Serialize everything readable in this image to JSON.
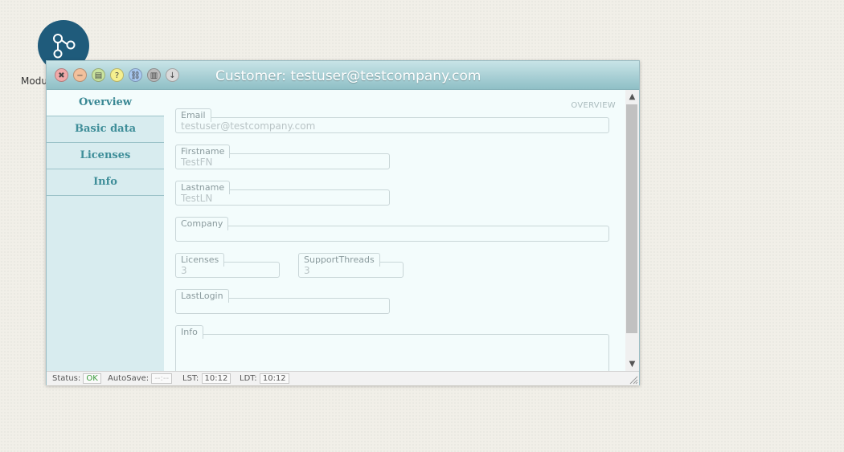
{
  "desktop": {
    "icon_label": "Modu"
  },
  "window": {
    "title": "Customer: testuser@testcompany.com",
    "titlebar_buttons": [
      {
        "name": "close-button",
        "glyph": "✖",
        "color": "#f0a9a9"
      },
      {
        "name": "minimize-button",
        "glyph": "−",
        "color": "#f2c09c"
      },
      {
        "name": "save-button",
        "glyph": "▤",
        "color": "#c9e39e"
      },
      {
        "name": "help-button",
        "glyph": "?",
        "color": "#f5ef8e"
      },
      {
        "name": "link-button",
        "glyph": "⛓",
        "color": "#a9c9f2"
      },
      {
        "name": "list-button",
        "glyph": "▥",
        "color": "#bbbbbb"
      },
      {
        "name": "download-button",
        "glyph": "↓",
        "color": "#dadada"
      }
    ]
  },
  "sidebar": {
    "items": [
      {
        "label": "Overview"
      },
      {
        "label": "Basic data"
      },
      {
        "label": "Licenses"
      },
      {
        "label": "Info"
      }
    ]
  },
  "content": {
    "section_tag": "OVERVIEW",
    "fields": {
      "email": {
        "label": "Email",
        "value": "testuser@testcompany.com"
      },
      "firstname": {
        "label": "Firstname",
        "value": "TestFN"
      },
      "lastname": {
        "label": "Lastname",
        "value": "TestLN"
      },
      "company": {
        "label": "Company",
        "value": ""
      },
      "licenses": {
        "label": "Licenses",
        "value": "3"
      },
      "supportthreads": {
        "label": "SupportThreads",
        "value": "3"
      },
      "lastlogin": {
        "label": "LastLogin",
        "value": ""
      },
      "info": {
        "label": "Info",
        "value": ""
      }
    }
  },
  "statusbar": {
    "status_label": "Status:",
    "status_value": "OK",
    "autosave_label": "AutoSave:",
    "autosave_value": "--:--",
    "lst_label": "LST:",
    "lst_value": "10:12",
    "ldt_label": "LDT:",
    "ldt_value": "10:12"
  }
}
